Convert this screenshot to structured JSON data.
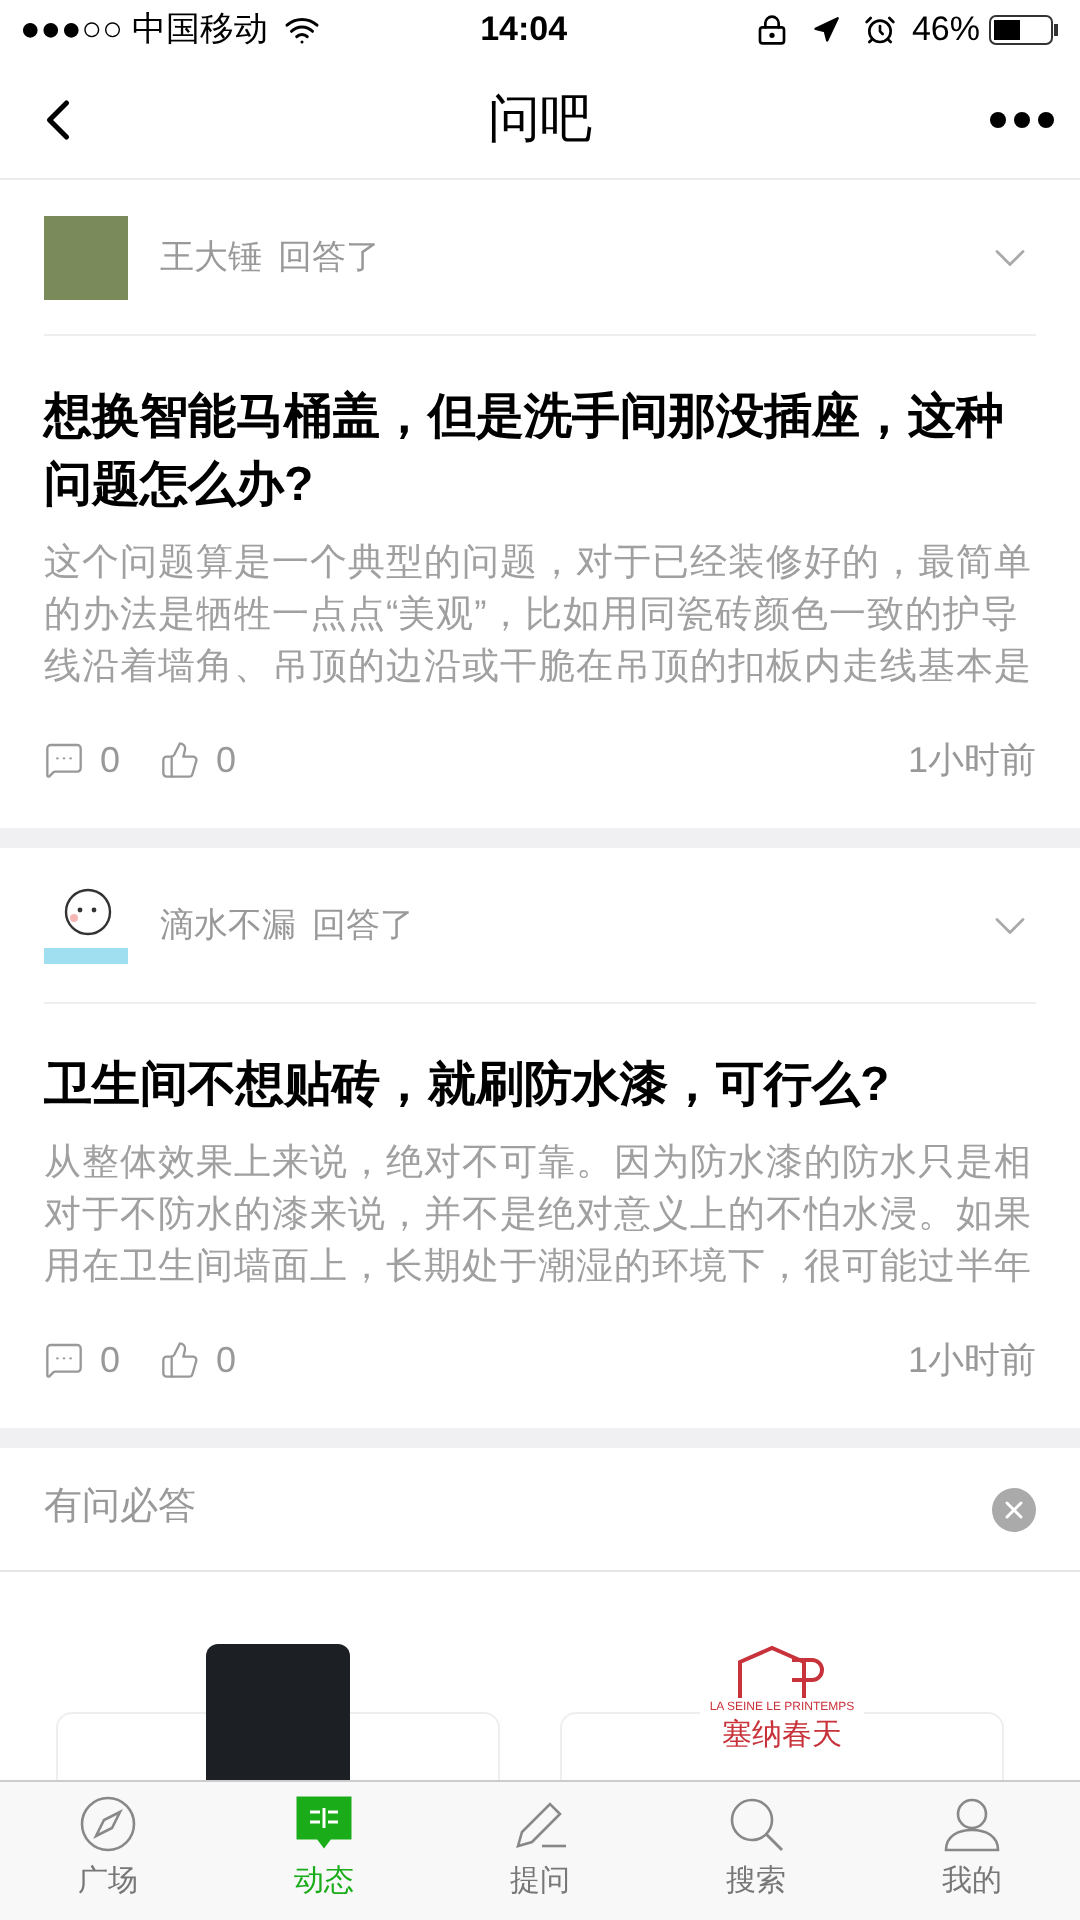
{
  "status_bar": {
    "carrier": "●●●○○ 中国移动",
    "time": "14:04",
    "battery": "46%"
  },
  "nav": {
    "title": "问吧"
  },
  "posts": [
    {
      "author": "王大锤",
      "action": "回答了",
      "question": "想换智能马桶盖，但是洗手间那没插座，这种问题怎么办?",
      "answer": "这个问题算是一个典型的问题，对于已经装修好的，最简单的办法是牺牲一点点“美观”，比如用同瓷砖颜色一致的护导线沿着墙角、吊顶的边沿或干脆在吊顶的扣板内走线基本是",
      "comments": "0",
      "likes": "0",
      "time": "1小时前"
    },
    {
      "author": "滴水不漏",
      "action": "回答了",
      "question": "卫生间不想贴砖，就刷防水漆，可行么?",
      "answer": "从整体效果上来说，绝对不可靠。因为防水漆的防水只是相对于不防水的漆来说，并不是绝对意义上的不怕水浸。如果用在卫生间墙面上，长期处于潮湿的环境下，很可能过半年",
      "comments": "0",
      "likes": "0",
      "time": "1小时前"
    }
  ],
  "recommend": {
    "title": "有问必答",
    "cards": [
      {
        "kind": "photo"
      },
      {
        "kind": "logo",
        "brand": "塞纳春天",
        "tagline": "LA SEINE LE PRINTEMPS"
      }
    ]
  },
  "tab_bar": [
    {
      "label": "广场",
      "selected": false
    },
    {
      "label": "动态",
      "selected": true
    },
    {
      "label": "提问",
      "selected": false
    },
    {
      "label": "搜索",
      "selected": false
    },
    {
      "label": "我的",
      "selected": false
    }
  ]
}
